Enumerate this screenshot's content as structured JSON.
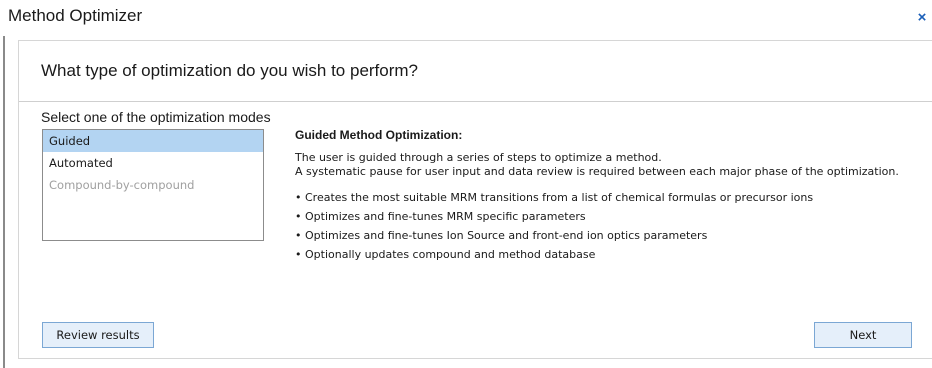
{
  "window": {
    "title": "Method Optimizer",
    "close_glyph": "×"
  },
  "main": {
    "question": "What type of optimization do you wish to perform?",
    "select_label": "Select one of the optimization modes",
    "modes": [
      {
        "label": "Guided",
        "state": "selected"
      },
      {
        "label": "Automated",
        "state": "enabled"
      },
      {
        "label": "Compound-by-compound",
        "state": "disabled"
      }
    ],
    "description": {
      "title": "Guided Method Optimization:",
      "lines": [
        "The user is guided through a series of steps to optimize a method.",
        "A systematic pause for user input and data review is required between each major phase of the optimization."
      ],
      "bullet_glyph": "•",
      "bullets": [
        "Creates the most suitable MRM transitions from a list of chemical formulas or precursor ions",
        "Optimizes and fine-tunes MRM specific parameters",
        "Optimizes and fine-tunes Ion Source and front-end ion optics parameters",
        "Optionally updates compound and method database"
      ]
    }
  },
  "footer": {
    "review_label": "Review results",
    "next_label": "Next"
  },
  "colors": {
    "selected_bg": "#b3d4f2",
    "button_bg": "#e5effa",
    "button_border": "#7ba7d4",
    "close_icon": "#1b5fb8",
    "disabled_text": "#a0a0a0"
  },
  "icons": {
    "close": "close-icon"
  }
}
